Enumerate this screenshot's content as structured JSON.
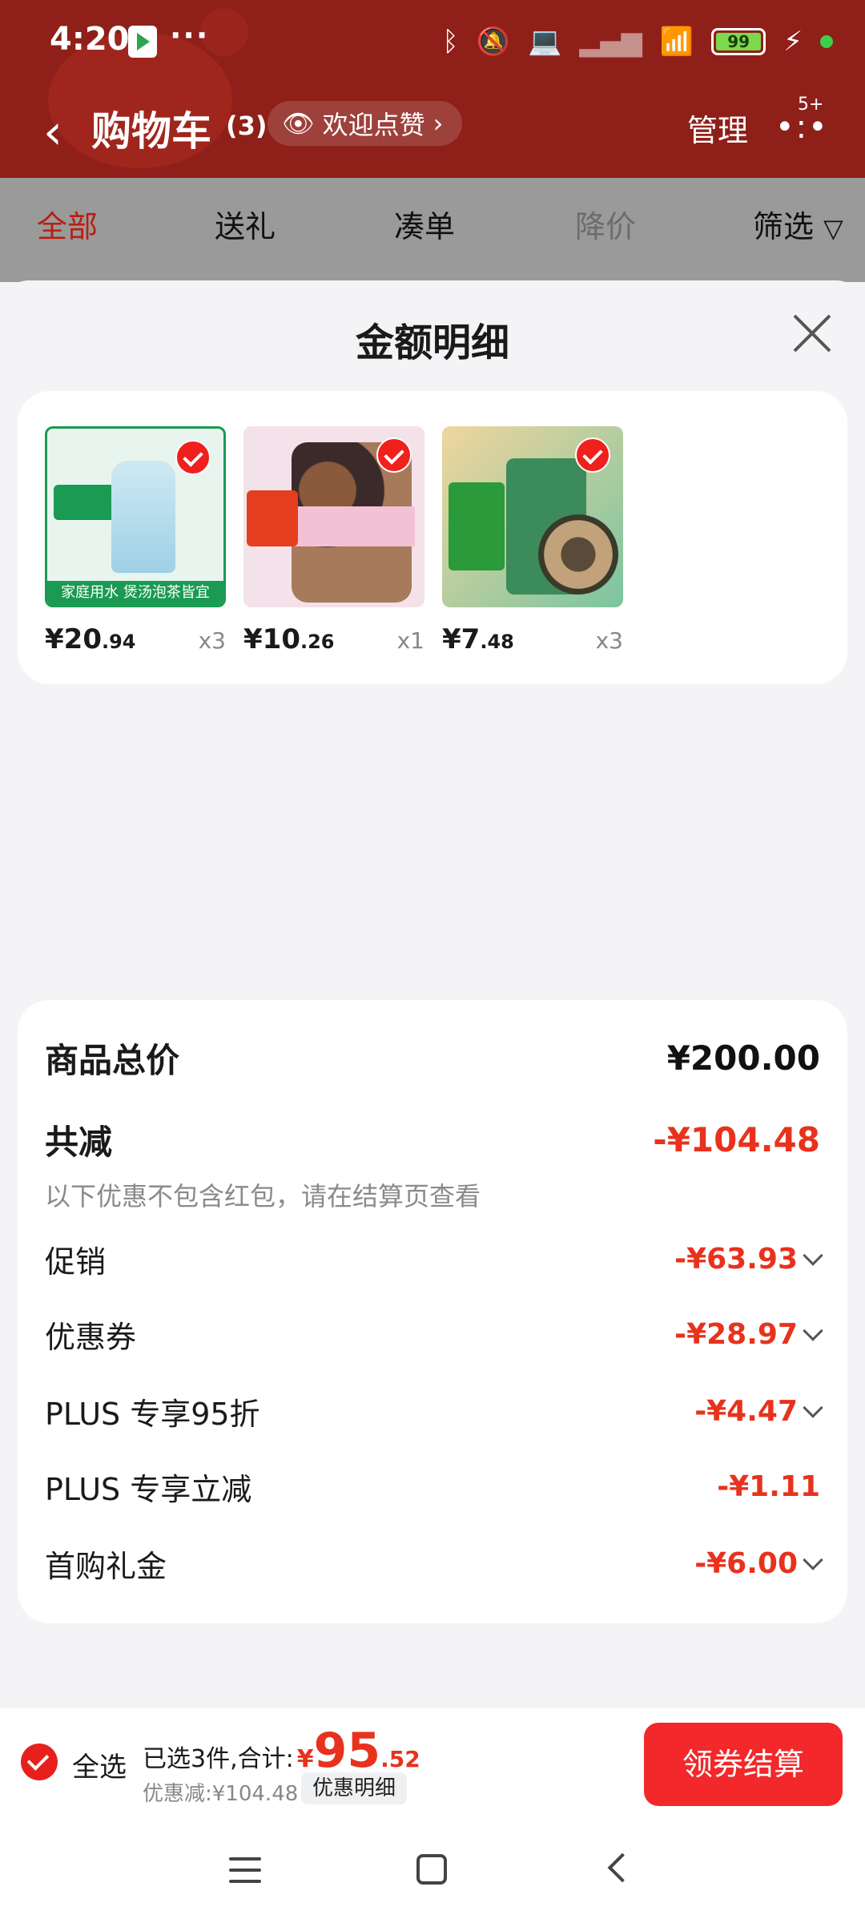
{
  "status_bar": {
    "time": "4:20",
    "battery": "99"
  },
  "header": {
    "title": "购物车",
    "count": "(3)",
    "welcome": "欢迎点赞",
    "manage": "管理",
    "badge": "5+"
  },
  "tabs": [
    "全部",
    "送礼",
    "凑单",
    "降价",
    "筛选"
  ],
  "sheet": {
    "title": "金额明细",
    "products": [
      {
        "price_int": "¥20",
        "price_dec": ".94",
        "qty": "x3",
        "band_text": "家庭用水 煲汤泡茶皆宜"
      },
      {
        "price_int": "¥10",
        "price_dec": ".26",
        "qty": "x1"
      },
      {
        "price_int": "¥7",
        "price_dec": ".48",
        "qty": "x3"
      }
    ],
    "summary": {
      "total_label": "商品总价",
      "total_value": "¥200.00",
      "reduce_label": "共减",
      "reduce_value": "-¥104.48",
      "note": "以下优惠不包含红包，请在结算页查看",
      "items": [
        {
          "label": "促销",
          "value": "-¥63.93"
        },
        {
          "label": "优惠券",
          "value": "-¥28.97"
        },
        {
          "label": "PLUS 专享95折",
          "value": "-¥4.47"
        },
        {
          "label": "PLUS 专享立减",
          "value": "-¥1.11"
        },
        {
          "label": "首购礼金",
          "value": "-¥6.00"
        }
      ]
    }
  },
  "bottom": {
    "select_all": "全选",
    "selected_text": "已选3件,合计:",
    "currency": "¥",
    "total_int": "95",
    "total_dec": ".52",
    "discount_text": "优惠减:¥104.48",
    "detail_button": "优惠明细",
    "checkout": "领券结算"
  },
  "colors": {
    "accent": "#e8321d",
    "header_bg": "#8e2019",
    "checkout_bg": "#f2282a"
  }
}
